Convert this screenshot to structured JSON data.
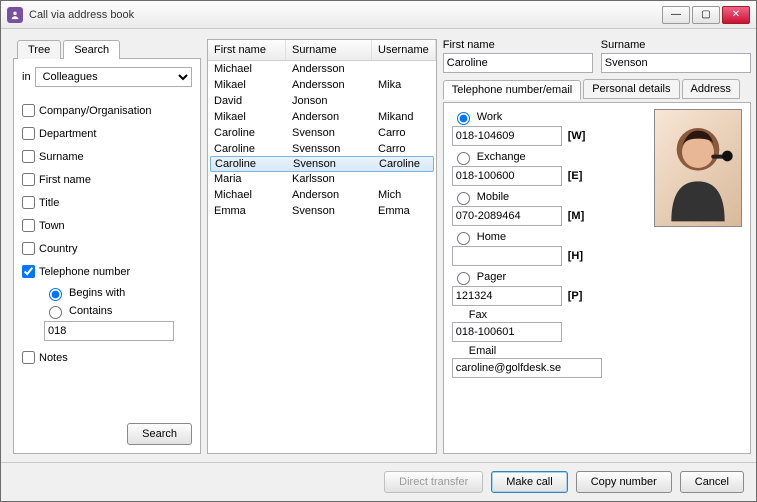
{
  "window": {
    "title": "Call via address book"
  },
  "leftTabs": {
    "tree": "Tree",
    "search": "Search"
  },
  "search": {
    "inLabel": "in",
    "scope": "Colleagues",
    "filters": {
      "company": "Company/Organisation",
      "department": "Department",
      "surname": "Surname",
      "firstname": "First name",
      "title": "Title",
      "town": "Town",
      "country": "Country",
      "telephone": "Telephone number",
      "notes": "Notes"
    },
    "telopts": {
      "begins": "Begins with",
      "contains": "Contains",
      "value": "018"
    },
    "button": "Search"
  },
  "list": {
    "headers": {
      "first": "First name",
      "surname": "Surname",
      "username": "Username"
    },
    "rows": [
      {
        "first": "Michael",
        "surname": "Andersson",
        "username": ""
      },
      {
        "first": "Mikael",
        "surname": "Andersson",
        "username": "Mika"
      },
      {
        "first": "David",
        "surname": "Jonson",
        "username": ""
      },
      {
        "first": "Mikael",
        "surname": "Anderson",
        "username": "Mikand"
      },
      {
        "first": "Caroline",
        "surname": "Svenson",
        "username": "Carro"
      },
      {
        "first": "Caroline",
        "surname": "Svensson",
        "username": "Carro"
      },
      {
        "first": "Caroline",
        "surname": "Svenson",
        "username": "Caroline"
      },
      {
        "first": "Maria",
        "surname": "Karlsson",
        "username": ""
      },
      {
        "first": "Michael",
        "surname": "Anderson",
        "username": "Mich"
      },
      {
        "first": "Emma",
        "surname": "Svenson",
        "username": "Emma"
      }
    ],
    "selected": 6
  },
  "details": {
    "firstLabel": "First name",
    "surnameLabel": "Surname",
    "firstValue": "Caroline",
    "surnameValue": "Svenson",
    "tabs": {
      "tel": "Telephone number/email",
      "pers": "Personal details",
      "addr": "Address"
    },
    "tel": {
      "work": {
        "label": "Work",
        "value": "018-104609",
        "suffix": "[W]"
      },
      "exchange": {
        "label": "Exchange",
        "value": "018-100600",
        "suffix": "[E]"
      },
      "mobile": {
        "label": "Mobile",
        "value": "070-2089464",
        "suffix": "[M]"
      },
      "home": {
        "label": "Home",
        "value": "",
        "suffix": "[H]"
      },
      "pager": {
        "label": "Pager",
        "value": "121324",
        "suffix": "[P]"
      },
      "fax": {
        "label": "Fax",
        "value": "018-100601"
      },
      "email": {
        "label": "Email",
        "value": "caroline@golfdesk.se"
      }
    }
  },
  "footer": {
    "direct": "Direct transfer",
    "make": "Make call",
    "copy": "Copy number",
    "cancel": "Cancel"
  }
}
